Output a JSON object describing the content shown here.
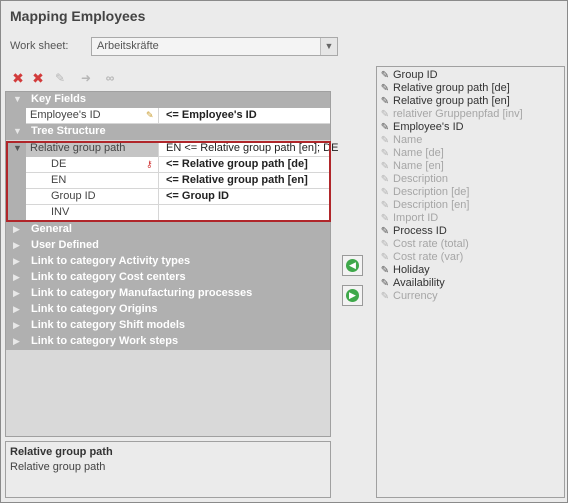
{
  "window": {
    "title": "Mapping Employees"
  },
  "worksheet": {
    "label": "Work sheet:",
    "value": "Arbeitskräfte"
  },
  "toolbar": {
    "icons": [
      "delete-icon",
      "delete-all-icon",
      "edit-icon",
      "arrow-icon",
      "link-icon"
    ]
  },
  "grid": {
    "key_fields": {
      "label": "Key Fields"
    },
    "employee_id": {
      "name": "Employee's ID",
      "value": "<= Employee's ID"
    },
    "tree_structure": {
      "label": "Tree Structure"
    },
    "relative_group_path": {
      "name": "Relative group path",
      "value": "EN <= Relative group path [en]; DE"
    },
    "de": {
      "name": "DE",
      "value": "<= Relative group path [de]"
    },
    "en": {
      "name": "EN",
      "value": "<= Relative group path [en]"
    },
    "group_id": {
      "name": "Group ID",
      "value": "<= Group ID"
    },
    "inv": {
      "name": "INV",
      "value": ""
    },
    "categories": [
      "General",
      "User Defined",
      "Link to category Activity types",
      "Link to category Cost centers",
      "Link to category Manufacturing processes",
      "Link to category Origins",
      "Link to category Shift models",
      "Link to category Work steps"
    ]
  },
  "description": {
    "heading": "Relative group path",
    "text": "Relative group path"
  },
  "fields": [
    {
      "label": "Group ID",
      "active": true
    },
    {
      "label": "Relative group path [de]",
      "active": true
    },
    {
      "label": "Relative group path [en]",
      "active": true
    },
    {
      "label": "relativer Gruppenpfad [inv]",
      "active": false
    },
    {
      "label": "Employee's ID",
      "active": true
    },
    {
      "label": "Name",
      "active": false
    },
    {
      "label": "Name [de]",
      "active": false
    },
    {
      "label": "Name [en]",
      "active": false
    },
    {
      "label": "Description",
      "active": false
    },
    {
      "label": "Description [de]",
      "active": false
    },
    {
      "label": "Description [en]",
      "active": false
    },
    {
      "label": "Import ID",
      "active": false
    },
    {
      "label": "Process ID",
      "active": true
    },
    {
      "label": "Cost rate (total)",
      "active": false
    },
    {
      "label": "Cost rate (var)",
      "active": false
    },
    {
      "label": "Holiday",
      "active": true
    },
    {
      "label": "Availability",
      "active": true
    },
    {
      "label": "Currency",
      "active": false
    }
  ],
  "colors": {
    "highlight": "#b0262a",
    "category": "#b0b0b0",
    "accent_green": "#3ea84a",
    "delete_red": "#d23b3b"
  }
}
